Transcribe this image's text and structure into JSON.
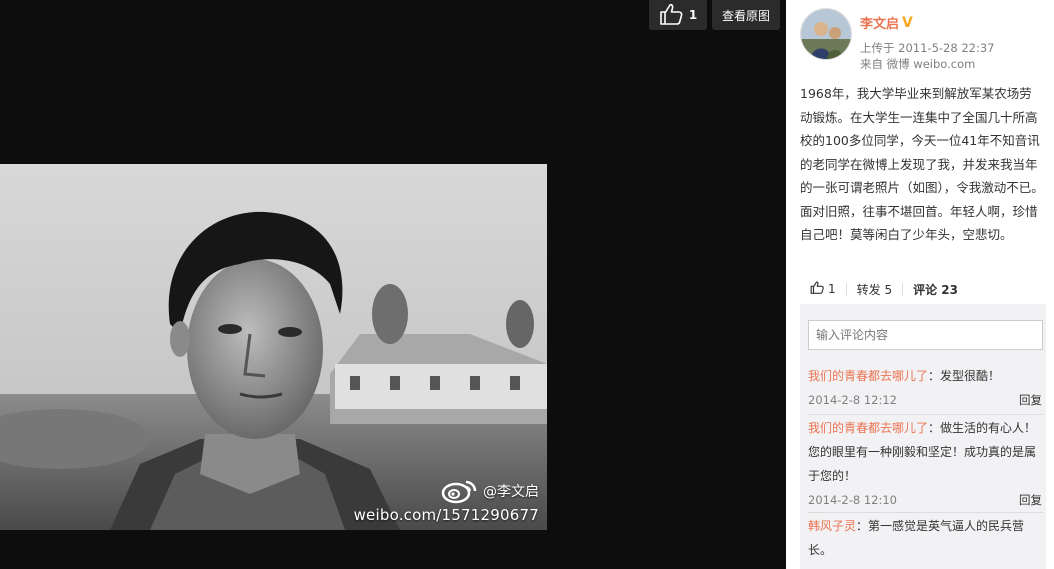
{
  "viewer": {
    "like_count": "1",
    "view_original_label": "查看原图",
    "watermark_user": "@李文启",
    "watermark_url": "weibo.com/1571290677"
  },
  "post": {
    "author": "李文启",
    "verified_badge": "V",
    "uploaded": "上传于 2011-5-28 22:37",
    "source": "来自 微博 weibo.com",
    "text": "1968年，我大学毕业来到解放军某农场劳动锻炼。在大学生一连集中了全国几十所高校的100多位同学，今天一位41年不知音讯的老同学在微博上发现了我，并发来我当年的一张可谓老照片（如图），令我激动不已。面对旧照，往事不堪回首。年轻人啊，珍惜自己吧！莫等闲白了少年头，空悲切。"
  },
  "actions": {
    "like_count": "1",
    "repost_label": "转发 5",
    "comment_label": "评论 23"
  },
  "comments": {
    "input_placeholder": "输入评论内容",
    "items": [
      {
        "user": "我们的青春都去哪儿了",
        "text": "：发型很酷！",
        "time": "2014-2-8 12:12",
        "reply": "回复"
      },
      {
        "user": "我们的青春都去哪儿了",
        "text": "：做生活的有心人！您的眼里有一种刚毅和坚定！成功真的是属于您的！",
        "time": "2014-2-8 12:10",
        "reply": "回复"
      },
      {
        "user": "韩风子灵",
        "text": "：第一感觉是英气逼人的民兵营长。",
        "time": "",
        "reply": ""
      }
    ]
  },
  "colors": {
    "accent": "#eb7350",
    "badge": "#f6a623",
    "page_bg": "#0d0d0d"
  }
}
